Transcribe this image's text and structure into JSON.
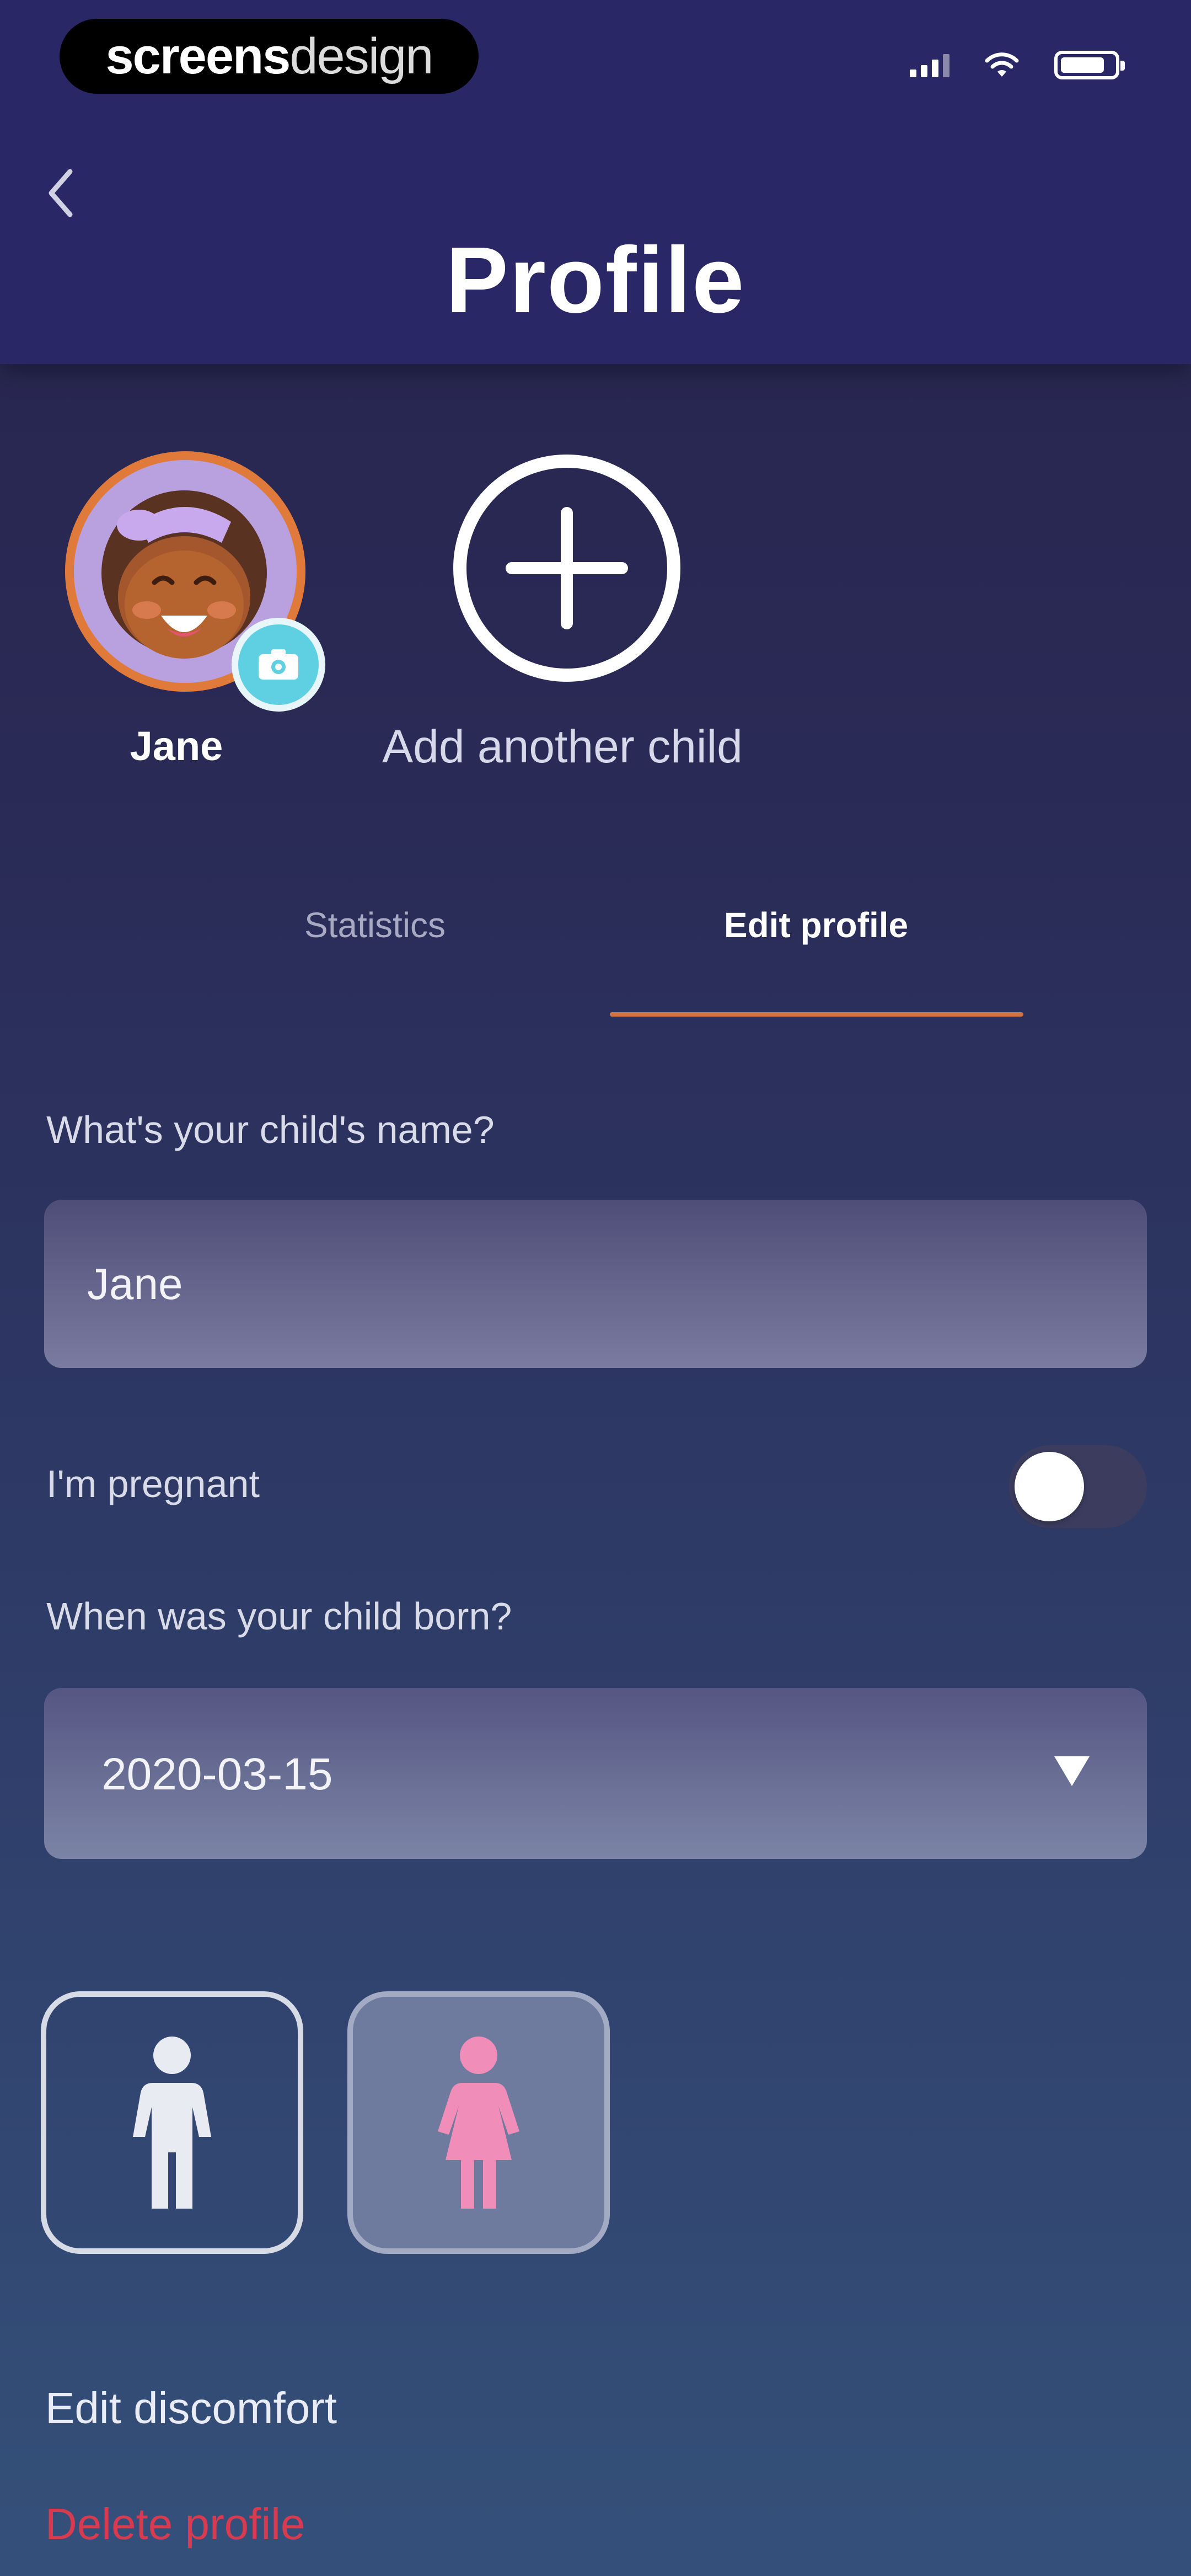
{
  "status_bar": {
    "watermark_bold": "screens",
    "watermark_light": "design"
  },
  "header": {
    "title": "Profile"
  },
  "profiles": {
    "child_name": "Jane",
    "add_child_label": "Add another child"
  },
  "tabs": [
    {
      "label": "Statistics",
      "active": false
    },
    {
      "label": "Edit profile",
      "active": true
    }
  ],
  "form": {
    "name_label": "What's your child's name?",
    "name_value": "Jane",
    "pregnant_label": "I'm pregnant",
    "pregnant_on": false,
    "birth_label": "When was your child born?",
    "birth_date": "2020-03-15",
    "gender_options": [
      {
        "icon": "boy-icon",
        "color": "#e8ebf2",
        "selected": false
      },
      {
        "icon": "girl-icon",
        "color": "#f08db8",
        "selected": true
      }
    ]
  },
  "links": {
    "edit_discomfort": "Edit discomfort",
    "delete_profile": "Delete profile"
  },
  "colors": {
    "header_bg": "#2a2766",
    "accent_orange": "#d07442",
    "camera_badge": "#5fd0e2",
    "delete_red": "#d83a50"
  }
}
